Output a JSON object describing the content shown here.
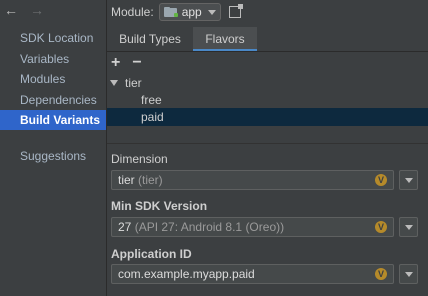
{
  "nav": {
    "back_icon": "arrow-left-icon",
    "forward_icon": "arrow-right-icon"
  },
  "sidebar": {
    "items": [
      {
        "label": "SDK Location"
      },
      {
        "label": "Variables"
      },
      {
        "label": "Modules"
      },
      {
        "label": "Dependencies"
      },
      {
        "label": "Build Variants",
        "selected": true
      },
      {
        "label": "Suggestions"
      }
    ]
  },
  "module": {
    "label": "Module:",
    "value": "app"
  },
  "tabs": [
    {
      "label": "Build Types"
    },
    {
      "label": "Flavors",
      "active": true
    }
  ],
  "toolbar": {
    "add": "+",
    "remove": "−"
  },
  "tree": {
    "dimension": "tier",
    "flavors": [
      {
        "label": "free"
      },
      {
        "label": "paid",
        "selected": true
      }
    ]
  },
  "fields": {
    "dimension": {
      "label": "Dimension",
      "value": "tier",
      "hint": "(tier)"
    },
    "min_sdk": {
      "label": "Min SDK Version",
      "value": "27",
      "hint": "(API 27: Android 8.1 (Oreo))"
    },
    "app_id": {
      "label": "Application ID",
      "value": "com.example.myapp.paid"
    },
    "var_badge": "V"
  },
  "colors": {
    "selection": "#2f65ca",
    "tree_selection": "#0d293e",
    "variable_badge": "#b58a2a"
  }
}
